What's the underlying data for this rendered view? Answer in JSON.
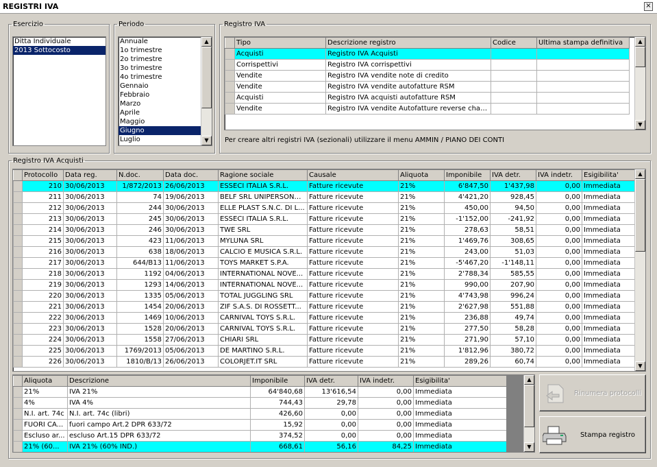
{
  "window": {
    "title": "REGISTRI IVA",
    "close": "×"
  },
  "esercizio": {
    "legend": "Esercizio",
    "items": [
      "Ditta Individuale",
      "2013 Sottocosto"
    ]
  },
  "periodo": {
    "legend": "Periodo",
    "items": [
      "Annuale",
      "1o trimestre",
      "2o trimestre",
      "3o trimestre",
      "4o trimestre",
      "Gennaio",
      "Febbraio",
      "Marzo",
      "Aprile",
      "Maggio",
      "Giugno",
      "Luglio"
    ]
  },
  "registro_iva": {
    "legend": "Registro IVA",
    "headers": [
      "Tipo",
      "Descrizione registro",
      "Codice",
      "Ultima stampa definitiva"
    ],
    "rows": [
      [
        "Acquisti",
        "Registro IVA Acquisti",
        "",
        ""
      ],
      [
        "Corrispettivi",
        "Registro IVA corrispettivi",
        "",
        ""
      ],
      [
        "Vendite",
        "Registro IVA vendite note di credito",
        "",
        ""
      ],
      [
        "Vendite",
        "Registro IVA vendite autofatture RSM",
        "",
        ""
      ],
      [
        "Acquisti",
        "Registro IVA acquisti autofatture RSM",
        "",
        ""
      ],
      [
        "Vendite",
        "Registro IVA vendite Autofatture reverse charge",
        "",
        ""
      ]
    ],
    "note": "Per creare altri registri IVA (sezionali) utilizzare il menu AMMIN / PIANO DEI CONTI"
  },
  "acquisti": {
    "legend": "Registro IVA Acquisti",
    "headers": [
      "Protocollo",
      "Data reg.",
      "N.doc.",
      "Data doc.",
      "Ragione sociale",
      "Causale",
      "Aliquota",
      "Imponibile",
      "IVA detr.",
      "IVA indetr.",
      "Esigibilita'"
    ],
    "rows": [
      [
        "210",
        "30/06/2013",
        "1/872/2013",
        "26/06/2013",
        "ESSECI ITALIA S.R.L.",
        "Fatture ricevute",
        "21%",
        "6'847,50",
        "1'437,98",
        "0,00",
        "Immediata"
      ],
      [
        "211",
        "30/06/2013",
        "74",
        "19/06/2013",
        "BELF SRL UNIPERSONALE",
        "Fatture ricevute",
        "21%",
        "4'421,20",
        "928,45",
        "0,00",
        "Immediata"
      ],
      [
        "212",
        "30/06/2013",
        "244",
        "30/06/2013",
        "ELLE PLAST S.N.C. DI L...",
        "Fatture ricevute",
        "21%",
        "450,00",
        "94,50",
        "0,00",
        "Immediata"
      ],
      [
        "213",
        "30/06/2013",
        "245",
        "30/06/2013",
        "ESSECI ITALIA S.R.L.",
        "Fatture ricevute",
        "21%",
        "-1'152,00",
        "-241,92",
        "0,00",
        "Immediata"
      ],
      [
        "214",
        "30/06/2013",
        "246",
        "30/06/2013",
        "TWE SRL",
        "Fatture ricevute",
        "21%",
        "278,63",
        "58,51",
        "0,00",
        "Immediata"
      ],
      [
        "215",
        "30/06/2013",
        "423",
        "11/06/2013",
        "MYLUNA SRL",
        "Fatture ricevute",
        "21%",
        "1'469,76",
        "308,65",
        "0,00",
        "Immediata"
      ],
      [
        "216",
        "30/06/2013",
        "638",
        "18/06/2013",
        "CALCIO E MUSICA S.R.L.",
        "Fatture ricevute",
        "21%",
        "243,00",
        "51,03",
        "0,00",
        "Immediata"
      ],
      [
        "217",
        "30/06/2013",
        "644/B13",
        "11/06/2013",
        "TOYS MARKET S.P.A.",
        "Fatture ricevute",
        "21%",
        "-5'467,20",
        "-1'148,11",
        "0,00",
        "Immediata"
      ],
      [
        "218",
        "30/06/2013",
        "1192",
        "04/06/2013",
        "INTERNATIONAL NOVE...",
        "Fatture ricevute",
        "21%",
        "2'788,34",
        "585,55",
        "0,00",
        "Immediata"
      ],
      [
        "219",
        "30/06/2013",
        "1293",
        "14/06/2013",
        "INTERNATIONAL NOVE...",
        "Fatture ricevute",
        "21%",
        "990,00",
        "207,90",
        "0,00",
        "Immediata"
      ],
      [
        "220",
        "30/06/2013",
        "1335",
        "05/06/2013",
        "TOTAL JUGGLING SRL",
        "Fatture ricevute",
        "21%",
        "4'743,98",
        "996,24",
        "0,00",
        "Immediata"
      ],
      [
        "221",
        "30/06/2013",
        "1454",
        "20/06/2013",
        "ZIF S.A.S. DI ROSSETT...",
        "Fatture ricevute",
        "21%",
        "2'627,98",
        "551,88",
        "0,00",
        "Immediata"
      ],
      [
        "222",
        "30/06/2013",
        "1469",
        "10/06/2013",
        "CARNIVAL TOYS S.R.L.",
        "Fatture ricevute",
        "21%",
        "236,88",
        "49,74",
        "0,00",
        "Immediata"
      ],
      [
        "223",
        "30/06/2013",
        "1528",
        "20/06/2013",
        "CARNIVAL TOYS S.R.L.",
        "Fatture ricevute",
        "21%",
        "277,50",
        "58,28",
        "0,00",
        "Immediata"
      ],
      [
        "224",
        "30/06/2013",
        "1558",
        "27/06/2013",
        "CHIARI SRL",
        "Fatture ricevute",
        "21%",
        "271,90",
        "57,10",
        "0,00",
        "Immediata"
      ],
      [
        "225",
        "30/06/2013",
        "1769/2013",
        "05/06/2013",
        "DE MARTINO S.R.L.",
        "Fatture ricevute",
        "21%",
        "1'812,96",
        "380,72",
        "0,00",
        "Immediata"
      ],
      [
        "226",
        "30/06/2013",
        "1810/B/13",
        "26/06/2013",
        "COLORJET.IT SRL",
        "Fatture ricevute",
        "21%",
        "289,26",
        "60,74",
        "0,00",
        "Immediata"
      ]
    ]
  },
  "riepilogo": {
    "headers": [
      "Aliquota",
      "Descrizione",
      "Imponibile",
      "IVA detr.",
      "IVA indetr.",
      "Esigibilita'"
    ],
    "rows": [
      [
        "21%",
        "IVA 21%",
        "64'840,68",
        "13'616,54",
        "0,00",
        "Immediata"
      ],
      [
        "4%",
        "IVA 4%",
        "744,43",
        "29,78",
        "0,00",
        "Immediata"
      ],
      [
        "N.I. art. 74c",
        "N.I. art. 74c (libri)",
        "426,60",
        "0,00",
        "0,00",
        "Immediata"
      ],
      [
        "FUORI CA...",
        "fuori campo Art.2 DPR 633/72",
        "15,92",
        "0,00",
        "0,00",
        "Immediata"
      ],
      [
        "Escluso ar...",
        "escluso Art.15 DPR 633/72",
        "374,52",
        "0,00",
        "0,00",
        "Immediata"
      ],
      [
        "21% (60...",
        "IVA 21% (60% IND.)",
        "668,61",
        "56,16",
        "84,25",
        "Immediata"
      ]
    ]
  },
  "buttons": {
    "rinumera": "Rinumera protocolli",
    "stampa": "Stampa registro"
  }
}
